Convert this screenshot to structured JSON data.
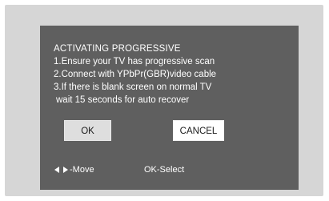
{
  "dialog": {
    "title": "ACTIVATING PROGRESSIVE",
    "lines": [
      "1.Ensure your TV has progressive scan",
      "2.Connect with YPbPr(GBR)video cable",
      "3.If there is blank screen on normal TV",
      " wait 15 seconds for auto recover"
    ]
  },
  "buttons": {
    "ok_label": "OK",
    "cancel_label": "CANCEL"
  },
  "hints": {
    "move_icons": [
      "arrow-left-icon",
      "arrow-right-icon"
    ],
    "move_label": "-Move",
    "select_label": "OK-Select"
  },
  "colors": {
    "frame": "#d6d6d6",
    "dialog": "#5f5f5f",
    "text": "#ffffff",
    "ok_button": "#dedede",
    "cancel_button": "#ffffff"
  }
}
